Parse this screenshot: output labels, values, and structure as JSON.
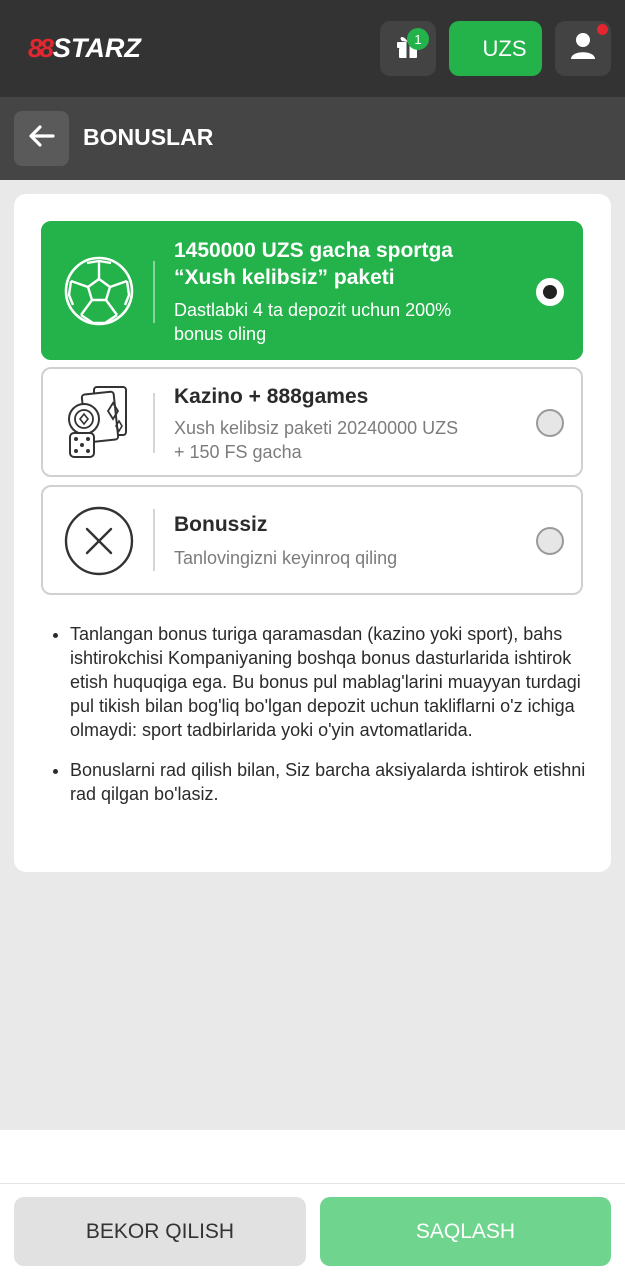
{
  "header": {
    "logo_mark": "88",
    "logo_word": "STARZ",
    "gift_badge_count": "1",
    "currency_label": "UZS",
    "icons": {
      "gift": "gift-icon",
      "user": "user-icon",
      "notification_dot": "red"
    }
  },
  "subheader": {
    "back_icon": "arrow-left-icon",
    "title": "BONUSLAR"
  },
  "bonus_options": [
    {
      "title_line1": "1450000 UZS gacha sportga",
      "title_line2": "“Xush kelibsiz” paketi",
      "desc_line1": "Dastlabki 4 ta depozit uchun 200%",
      "desc_line2": "bonus oling",
      "icon": "football-icon",
      "selected": true
    },
    {
      "title_line1": "Kazino + 888games",
      "desc_line1": "Xush kelibsiz paketi 20240000 UZS",
      "desc_line2": "+ 150 FS gacha",
      "icon": "casino-icon",
      "selected": false
    },
    {
      "title_line1": "Bonussiz",
      "desc_line1": "Tanlovingizni keyinroq qiling",
      "icon": "no-bonus-icon",
      "selected": false
    }
  ],
  "notes": [
    "Tanlangan bonus turiga qaramasdan (kazino yoki sport), bahs ishtirokchisi Kompaniyaning boshqa bonus dasturlarida ishtirok etish huquqiga ega. Bu bonus pul mablag'larini muayyan turdagi pul tikish bilan bog'liq bo'lgan depozit uchun takliflarni o'z ichiga olmaydi: sport tadbirlarida yoki o'yin avtomatlarida.",
    "Bonuslarni rad qilish bilan, Siz barcha aksiyalarda ishtirok etishni rad qilgan bo'lasiz."
  ],
  "footer": {
    "cancel_label": "BEKOR QILISH",
    "save_label": "SAQLASH"
  },
  "colors": {
    "accent": "#23b34a",
    "brand_red": "#e3262f",
    "header_bg": "#333333",
    "save_disabled": "#6fd58e"
  }
}
